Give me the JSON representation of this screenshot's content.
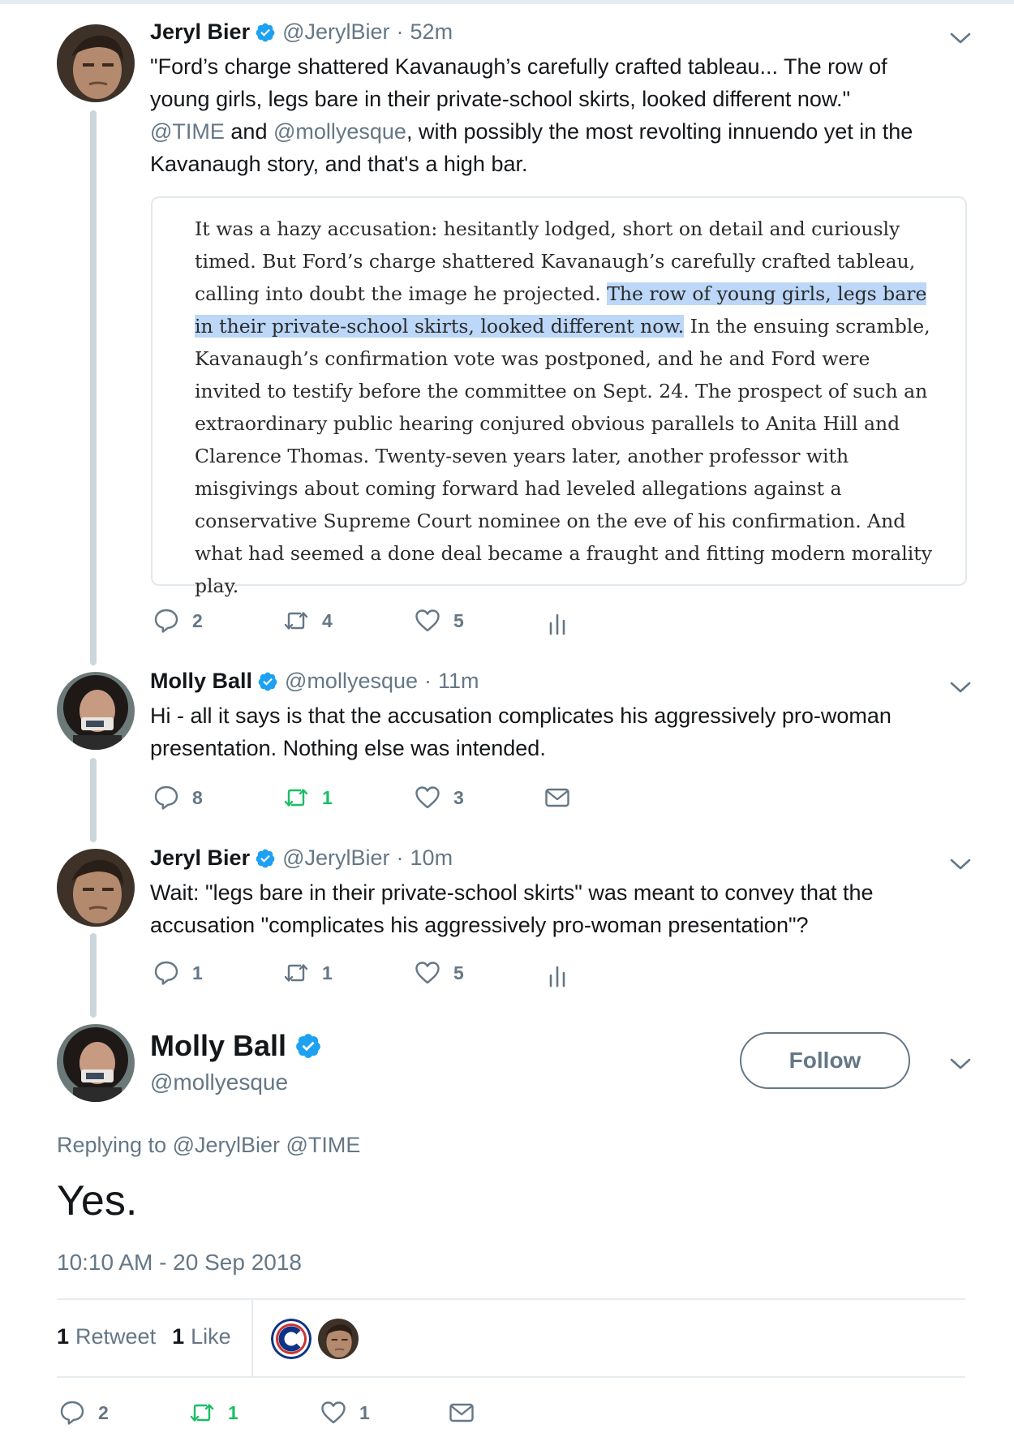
{
  "tweets": [
    {
      "name": "Jeryl Bier",
      "handle": "@JerylBier",
      "time": "52m",
      "text_lines": [
        "\"Ford’s charge shattered Kavanaugh’s carefully crafted tableau... The row of",
        "young girls, legs bare in their private-school skirts, looked different now.\""
      ],
      "text_mention_1": "@TIME",
      "text_mid": " and ",
      "text_mention_2": "@mollyesque",
      "text_rest": ", with possibly the most revolting innuendo yet in the",
      "text_last": "Kavanaugh story, and that's a high bar.",
      "quote_before": "It was a hazy accusation: hesitantly lodged, short on detail and curiously timed. But Ford’s charge shattered Kavanaugh’s carefully crafted tableau, calling into doubt the image he projected. ",
      "quote_highlight": "The row of young girls, legs bare in their private-school skirts, looked different now.",
      "quote_after": " In the ensuing scramble, Kavanaugh’s confirmation vote was postponed, and he and Ford were invited to testify before the committee on Sept. 24. The prospect of such an extraordinary public hearing conjured obvious parallels to Anita Hill and Clarence Thomas. Twenty-seven years later, another professor with misgivings about coming forward had leveled allegations against a conservative Supreme Court nominee on the eve of his confirmation. And what had seemed a done deal became a fraught and fitting modern morality play.",
      "replies": "2",
      "retweets": "4",
      "likes": "5",
      "last_icon": "analytics-icon"
    },
    {
      "name": "Molly Ball",
      "handle": "@mollyesque",
      "time": "11m",
      "text": "Hi - all it says is that the accusation complicates his aggressively pro-woman presentation. Nothing else was intended.",
      "replies": "8",
      "retweets": "1",
      "likes": "3",
      "last_icon": "envelope-icon"
    },
    {
      "name": "Jeryl Bier",
      "handle": "@JerylBier",
      "time": "10m",
      "text": "Wait: \"legs bare in their private-school skirts\" was meant to convey that the accusation \"complicates his aggressively pro-woman presentation\"?",
      "replies": "1",
      "retweets": "1",
      "likes": "5",
      "last_icon": "analytics-icon"
    }
  ],
  "main_tweet": {
    "name": "Molly Ball",
    "handle": "@mollyesque",
    "follow_label": "Follow",
    "replying_to": "Replying to @JerylBier @TIME",
    "text": "Yes.",
    "timestamp": "10:10 AM - 20 Sep 2018",
    "retweet_count": "1",
    "retweet_label": "Retweet",
    "like_count": "1",
    "like_label": "Like",
    "replies": "2",
    "retweets": "1",
    "likes": "1"
  },
  "colors": {
    "verified": "#1da1f2",
    "retweet_active": "#17bf63",
    "muted": "#657786",
    "highlight": "#bcd7f7"
  }
}
